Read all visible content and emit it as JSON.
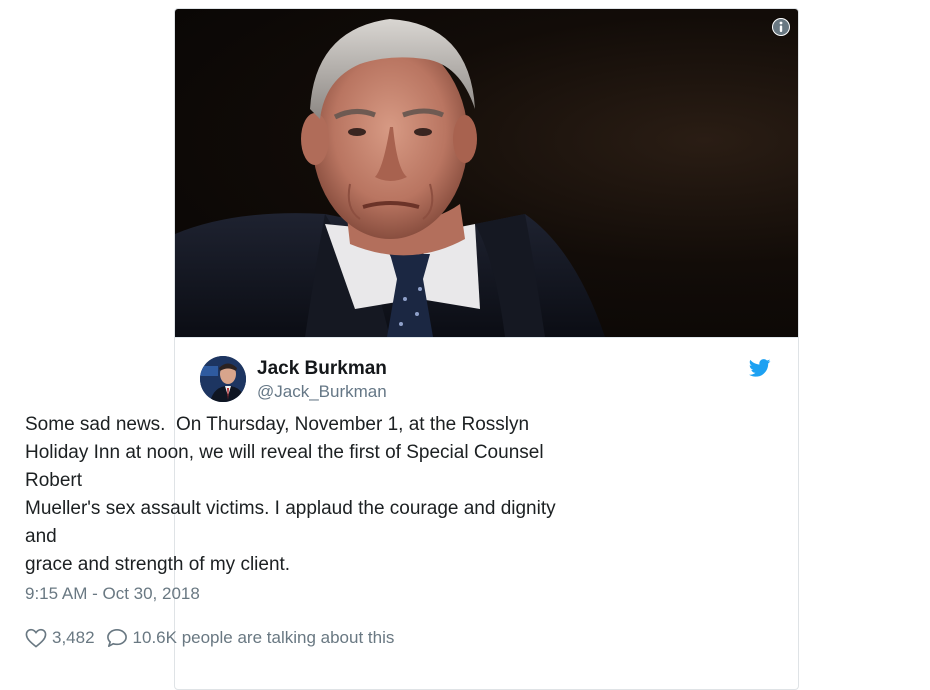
{
  "tweet": {
    "user": {
      "name": "Jack Burkman",
      "handle": "@Jack_Burkman"
    },
    "text_lines": [
      "Some sad news.  On Thursday, November 1, at the Rosslyn",
      "Holiday Inn at noon, we will reveal the first of Special Counsel",
      "Robert",
      "Mueller's sex assault victims. I applaud the courage and dignity",
      "and",
      "grace and strength of my client."
    ],
    "timestamp": "9:15 AM - Oct 30, 2018",
    "likes": "3,482",
    "conversation": "10.6K people are talking about this"
  },
  "icons": {
    "info": "info-icon",
    "brand": "twitter-bird-icon",
    "like": "heart-icon",
    "reply": "speech-bubble-icon"
  },
  "colors": {
    "brand": "#1da1f2",
    "text": "#1c2022",
    "muted": "#697882"
  }
}
